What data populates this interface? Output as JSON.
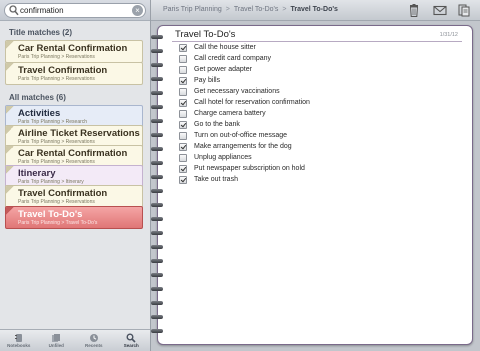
{
  "search": {
    "value": "confirmation"
  },
  "sections": {
    "title_matches": "Title matches (2)",
    "all_matches": "All matches (6)"
  },
  "title_matches": [
    {
      "title": "Car Rental Confirmation",
      "subtitle": "Paris Trip Planning > Reservations",
      "color": "yellow"
    },
    {
      "title": "Travel Confirmation",
      "subtitle": "Paris Trip Planning > Reservations",
      "color": "yellow"
    }
  ],
  "all_matches": [
    {
      "title": "Activities",
      "subtitle": "Paris Trip Planning > Research",
      "color": "blue"
    },
    {
      "title": "Airline Ticket Reservations",
      "subtitle": "Paris Trip Planning > Reservations",
      "color": "yellow"
    },
    {
      "title": "Car Rental Confirmation",
      "subtitle": "Paris Trip Planning > Reservations",
      "color": "yellow"
    },
    {
      "title": "Itinerary",
      "subtitle": "Paris Trip Planning > Itinerary",
      "color": "lavender"
    },
    {
      "title": "Travel Confirmation",
      "subtitle": "Paris Trip Planning > Reservations",
      "color": "yellow"
    },
    {
      "title": "Travel To-Do's",
      "subtitle": "Paris Trip Planning > Travel To-Do's",
      "color": "red",
      "selected": true
    }
  ],
  "tabs": [
    {
      "label": "Notebooks",
      "icon": "notebooks-icon"
    },
    {
      "label": "Unfiled",
      "icon": "unfiled-icon"
    },
    {
      "label": "Recents",
      "icon": "recents-icon"
    },
    {
      "label": "Search",
      "icon": "search-icon",
      "active": true
    }
  ],
  "breadcrumb": {
    "items": [
      "Paris Trip Planning",
      "Travel To-Do's"
    ],
    "current": "Travel To-Do's",
    "separator": ">"
  },
  "toolbar_icons": [
    "trash-icon",
    "mail-icon",
    "export-icon"
  ],
  "note": {
    "title": "Travel To-Do's",
    "date": "1/31/12",
    "items": [
      {
        "text": "Call the house sitter",
        "checked": true
      },
      {
        "text": "Call credit card company",
        "checked": false
      },
      {
        "text": "Get power adapter",
        "checked": false
      },
      {
        "text": "Pay bills",
        "checked": true
      },
      {
        "text": "Get necessary vaccinations",
        "checked": false
      },
      {
        "text": "Call hotel for reservation confirmation",
        "checked": true
      },
      {
        "text": "Charge camera battery",
        "checked": false
      },
      {
        "text": "Go to the bank",
        "checked": true
      },
      {
        "text": "Turn on out-of-office message",
        "checked": false
      },
      {
        "text": "Make arrangements for the dog",
        "checked": true
      },
      {
        "text": "Unplug appliances",
        "checked": false
      },
      {
        "text": "Put newspaper subscription on hold",
        "checked": true
      },
      {
        "text": "Take out trash",
        "checked": true
      }
    ]
  },
  "colors": {
    "selected_card": "#e07676",
    "paper_border": "#7a6a8a",
    "accent": "#6a5a8a"
  }
}
